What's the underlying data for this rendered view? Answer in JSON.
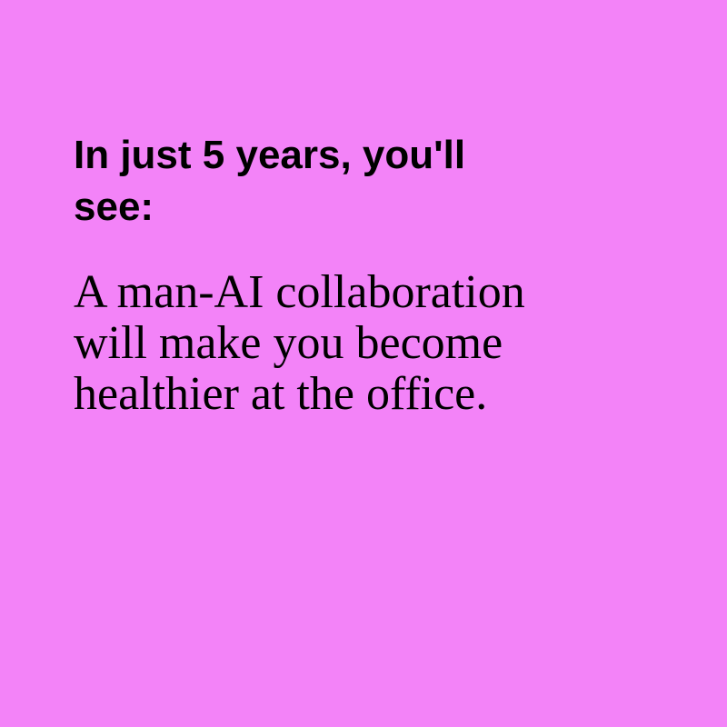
{
  "background_color": "#f383f8",
  "text_color": "#000000",
  "headline": {
    "lines": [
      "In just 5 years, you'll",
      "see:"
    ]
  },
  "body": {
    "lines": [
      "A man-AI collaboration",
      "will make you become",
      "healthier at the office."
    ]
  }
}
